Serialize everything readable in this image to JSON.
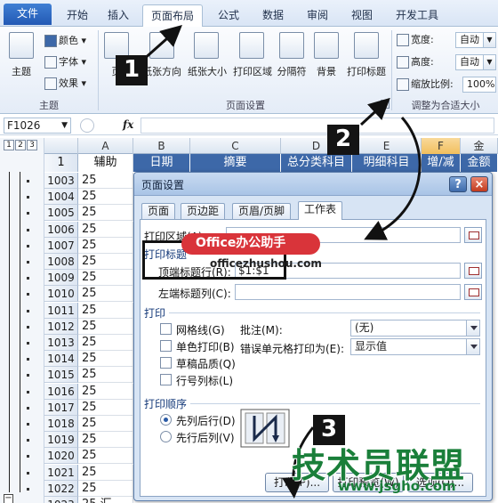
{
  "tabs": [
    "文件",
    "开始",
    "插入",
    "页面布局",
    "公式",
    "数据",
    "审阅",
    "视图",
    "开发工具"
  ],
  "ribbon": {
    "theme": {
      "main": "主题",
      "colors": "颜色",
      "fonts": "字体",
      "effects": "效果",
      "group": "主题"
    },
    "page_setup": {
      "margins": "页",
      "orientation": "纸张方向",
      "size": "纸张大小",
      "print_area": "打印区域",
      "breaks": "分隔符",
      "background": "背景",
      "print_titles": "打印标题",
      "group": "页面设置"
    },
    "scale": {
      "width_label": "宽度:",
      "width_value": "自动",
      "height_label": "高度:",
      "height_value": "自动",
      "scale_label": "缩放比例:",
      "scale_value": "100%",
      "group": "调整为合适大小"
    }
  },
  "formula_bar": {
    "name_box": "F1026",
    "fx": "fx",
    "content": ""
  },
  "grid": {
    "levels": [
      "1",
      "2",
      "3"
    ],
    "columns": [
      "A",
      "B",
      "C",
      "D",
      "E",
      "F",
      "金"
    ],
    "header_row_num": "1",
    "headers": [
      "辅助",
      "日期",
      "摘要",
      "总分类科目",
      "明细科目",
      "增/减",
      "金额"
    ],
    "rows": [
      {
        "num": "1003",
        "a": "25"
      },
      {
        "num": "1004",
        "a": "25"
      },
      {
        "num": "1005",
        "a": "25"
      },
      {
        "num": "1006",
        "a": "25"
      },
      {
        "num": "1007",
        "a": "25"
      },
      {
        "num": "1008",
        "a": "25"
      },
      {
        "num": "1009",
        "a": "25"
      },
      {
        "num": "1010",
        "a": "25"
      },
      {
        "num": "1011",
        "a": "25"
      },
      {
        "num": "1012",
        "a": "25"
      },
      {
        "num": "1013",
        "a": "25"
      },
      {
        "num": "1014",
        "a": "25"
      },
      {
        "num": "1015",
        "a": "25"
      },
      {
        "num": "1016",
        "a": "25"
      },
      {
        "num": "1017",
        "a": "25"
      },
      {
        "num": "1018",
        "a": "25"
      },
      {
        "num": "1019",
        "a": "25"
      },
      {
        "num": "1020",
        "a": "25"
      },
      {
        "num": "1021",
        "a": "25"
      },
      {
        "num": "1022",
        "a": "25"
      },
      {
        "num": "1023",
        "a": "25 汇"
      }
    ]
  },
  "dialog": {
    "title": "页面设置",
    "help": "?",
    "close": "×",
    "tabs": [
      "页面",
      "页边距",
      "页眉/页脚",
      "工作表"
    ],
    "print_area_label": "打印区域(A):",
    "print_titles_section": "打印标题",
    "rows_to_repeat_label": "顶端标题行(R):",
    "rows_to_repeat_value": "$1:$1",
    "cols_to_repeat_label": "左端标题列(C):",
    "print_section": "打印",
    "gridlines": "网格线(G)",
    "black_white": "单色打印(B)",
    "draft": "草稿品质(Q)",
    "row_col_headings": "行号列标(L)",
    "comments_label": "批注(M):",
    "comments_value": "(无)",
    "errors_label": "错误单元格打印为(E):",
    "errors_value": "显示值",
    "order_section": "打印顺序",
    "down_then_over": "先列后行(D)",
    "over_then_down": "先行后列(V)",
    "print_button": "打印(P)...",
    "preview_button": "打印预览(W)",
    "options_button": "选项(O)..."
  },
  "annotations": {
    "step1": "1",
    "step2": "2",
    "step3": "3",
    "badge": "Office办公助手",
    "badge_url": "officezhushou.com",
    "watermark": "技术员联盟",
    "watermark_url": "www.jsgho.com"
  },
  "colors": {
    "header_fill": "#3d68a8",
    "badge": "#d9343a",
    "watermark": "#1a7f3a",
    "accent": "#2359b4"
  }
}
